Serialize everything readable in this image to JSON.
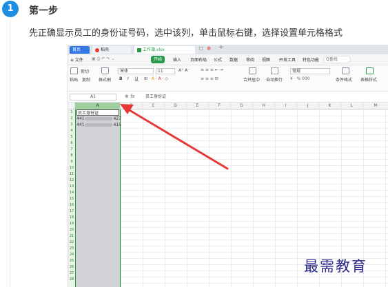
{
  "step": {
    "number": "1",
    "title": "第一步",
    "description": "先正确显示员工的身份证号码，选中该列，单击鼠标右键，选择设置单元格格式"
  },
  "wps": {
    "tabs": {
      "home": "首页",
      "wps": "稻壳",
      "file": "工作簿.xlsx"
    },
    "tab_controls": [
      "◻",
      "●",
      "+"
    ],
    "menu": {
      "file": "≡ 文件",
      "start": "开始",
      "items": [
        "插入",
        "页面布局",
        "公式",
        "数据",
        "审阅",
        "视图",
        "开发工具",
        "特色功能"
      ],
      "search": "Q查找"
    },
    "ribbon": {
      "cut": "剪切",
      "paste": "粘贴",
      "copy": "复制",
      "format_painter": "格式刷",
      "font_name": "宋体",
      "font_size": "11",
      "merge_center": "合并居中",
      "wrap": "自动换行",
      "number_format": "常规",
      "cond_format": "条件格式",
      "table_style": "表格样式",
      "bold": "B",
      "italic": "I",
      "underline": "U",
      "percent_row": "¥ · % 000"
    },
    "formula_bar": {
      "name_box": "A1",
      "fx": "fx",
      "content": "员工身份证"
    },
    "columns": [
      "A",
      "B",
      "C",
      "D",
      "E",
      "F",
      "G",
      "H",
      "I",
      "J",
      "K",
      "L",
      "M"
    ],
    "rows": [
      "1",
      "2",
      "3",
      "4",
      "5",
      "6",
      "7",
      "8",
      "9",
      "10",
      "11",
      "12",
      "13",
      "14",
      "15",
      "16",
      "17",
      "18",
      "19",
      "20",
      "21",
      "22",
      "23",
      "24",
      "25",
      "26",
      "27",
      "28"
    ],
    "cells": {
      "a1": "员工身份证",
      "a2_prefix": "441",
      "a2_suffix": "427",
      "a3_prefix": "441",
      "a3_suffix": "415"
    }
  },
  "watermark": "最需教育",
  "colors": {
    "accent": "#1e8ee0",
    "excel_green": "#2a9a4a",
    "arrow_red": "#e53935"
  }
}
